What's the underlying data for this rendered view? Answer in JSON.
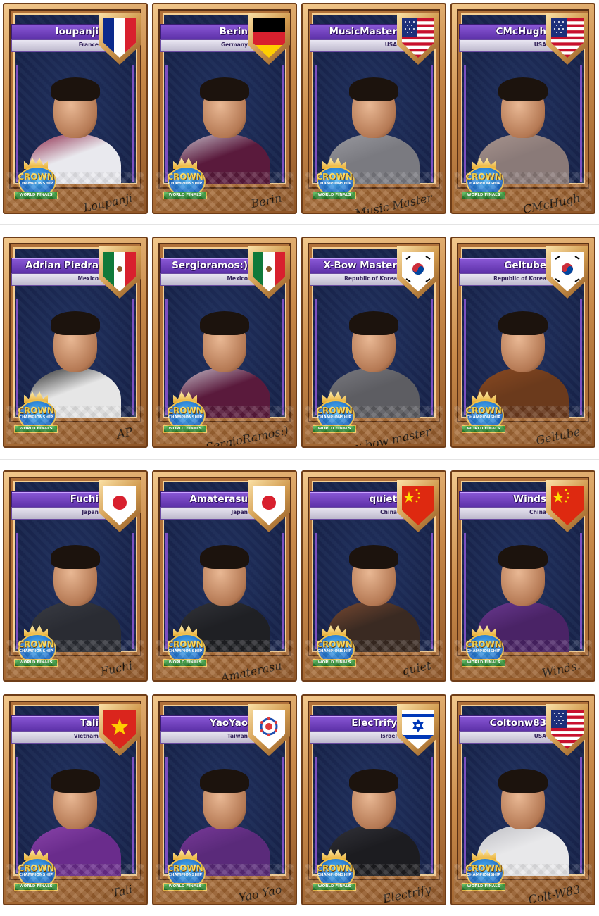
{
  "rows": [
    {
      "cards": [
        {
          "name": "loupanji",
          "country": "France",
          "flag": "france-flag",
          "signature": "Loupanji",
          "shirt": "#e9e9ee",
          "accent": "#8a2043",
          "skin": "light"
        },
        {
          "name": "Berin",
          "country": "Germany",
          "flag": "germany-flag",
          "signature": "Berin",
          "shirt": "#5a1a3c",
          "accent": "#c8c0cc",
          "skin": "light"
        },
        {
          "name": "MusicMaster",
          "country": "USA",
          "flag": "usa-flag",
          "signature": "Music Master",
          "shirt": "#7a7a80",
          "accent": "#9a9aa0",
          "skin": "light"
        },
        {
          "name": "CMcHugh",
          "country": "USA",
          "flag": "usa-flag",
          "signature": "CMcHugh",
          "shirt": "#8a7a78",
          "accent": "#a8948e",
          "skin": "light"
        }
      ]
    },
    {
      "cards": [
        {
          "name": "Adrian Piedra",
          "country": "Mexico",
          "flag": "mexico-flag",
          "signature": "AP",
          "shirt": "#e6e6e6",
          "accent": "#222222",
          "skin": "medium"
        },
        {
          "name": "Sergioramos:)",
          "country": "Mexico",
          "flag": "mexico-flag",
          "signature": "SergioRamos:)",
          "shirt": "#5a1a3c",
          "accent": "#c8c0cc",
          "skin": "medium"
        },
        {
          "name": "X-Bow Master",
          "country": "Republic of Korea",
          "flag": "korea-flag",
          "signature": "x-bow master",
          "shirt": "#5d5d62",
          "accent": "#7a7a80",
          "skin": "light"
        },
        {
          "name": "Geltube",
          "country": "Republic of Korea",
          "flag": "korea-flag",
          "signature": "Geltube",
          "shirt": "#6b3a1c",
          "accent": "#8a4a22",
          "skin": "light"
        }
      ]
    },
    {
      "cards": [
        {
          "name": "Fuchi",
          "country": "Japan",
          "flag": "japan-flag",
          "signature": "Fuchi",
          "shirt": "#2a2c33",
          "accent": "#3a3c44",
          "skin": "light"
        },
        {
          "name": "Amaterasu",
          "country": "Japan",
          "flag": "japan-flag",
          "signature": "Amaterasu",
          "shirt": "#1f2024",
          "accent": "#33343a",
          "skin": "light"
        },
        {
          "name": "quiet",
          "country": "China",
          "flag": "china-flag",
          "signature": "quiet",
          "shirt": "#3a2a22",
          "accent": "#7a4a32",
          "skin": "light"
        },
        {
          "name": "Winds",
          "country": "China",
          "flag": "china-flag",
          "signature": "Winds.",
          "shirt": "#4a2366",
          "accent": "#6b3a92",
          "skin": "light"
        }
      ]
    },
    {
      "cards": [
        {
          "name": "Tali",
          "country": "Vietnam",
          "flag": "vietnam-flag",
          "signature": "Tali",
          "shirt": "#6a2c8c",
          "accent": "#8a44aa",
          "skin": "light"
        },
        {
          "name": "YaoYao",
          "country": "Taiwan",
          "flag": "taiwan-flag",
          "signature": "Yao Yao",
          "shirt": "#5a2a7a",
          "accent": "#7a3a9a",
          "skin": "light"
        },
        {
          "name": "ElecTrify",
          "country": "Israel",
          "flag": "israel-flag",
          "signature": "Electrify",
          "shirt": "#1c1c20",
          "accent": "#33333a",
          "skin": "light"
        },
        {
          "name": "Coltonw83",
          "country": "USA",
          "flag": "usa-flag",
          "signature": "Colt-W83",
          "shirt": "#e8e8ea",
          "accent": "#bdbdc2",
          "skin": "light"
        }
      ]
    }
  ],
  "badge": {
    "top": "CROWN",
    "middle": "CHAMPIONSHIP",
    "ribbon": "WORLD FINALS"
  },
  "colors": {
    "nameplate": "#6b3cc0",
    "frame_gold": "#c98a4a",
    "background": "#1e2b52"
  }
}
